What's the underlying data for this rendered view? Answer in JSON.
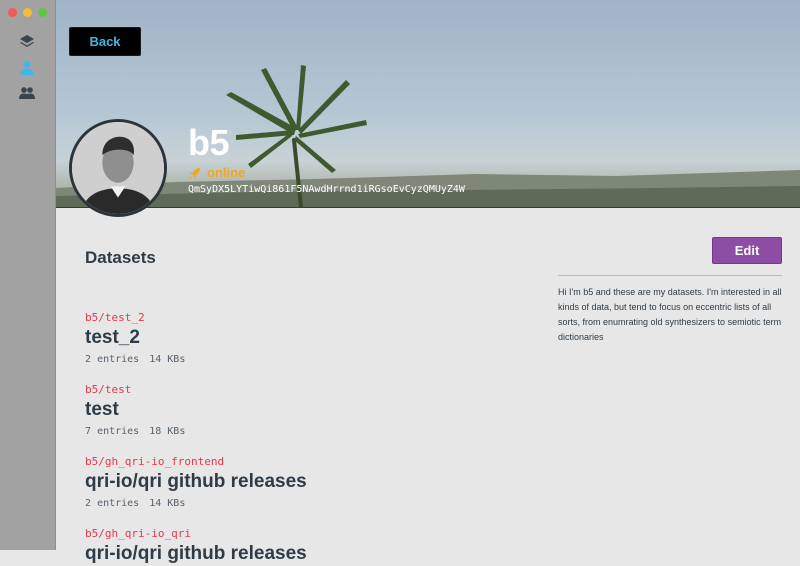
{
  "window": {
    "sidebar": {
      "icons": [
        "layers-icon",
        "user-icon",
        "users-icon"
      ],
      "active_icon": "user-icon",
      "active_color": "#3fb7e8"
    }
  },
  "header": {
    "back_label": "Back",
    "handle": "b5",
    "status": "online",
    "status_color": "#f3a421",
    "peer_id": "QmSyDX5LYTiwQi861F5NAwdHrrnd1iRGsoEvCyzQMUyZ4W"
  },
  "profile": {
    "edit_label": "Edit",
    "bio": "Hi I'm b5 and these are my datasets. I'm interested in all kinds of data, but tend to focus on eccentric lists of all sorts, from enumrating old synthesizers to semiotic term dictionaries"
  },
  "datasets": {
    "title": "Datasets",
    "items": [
      {
        "path": "b5/test_2",
        "name": "test_2",
        "entries": "2",
        "entries_label": "entries",
        "size": "14 KBs"
      },
      {
        "path": "b5/test",
        "name": "test",
        "entries": "7",
        "entries_label": "entries",
        "size": "18 KBs"
      },
      {
        "path": "b5/gh_qri-io_frontend",
        "name": "qri-io/qri github releases",
        "entries": "2",
        "entries_label": "entries",
        "size": "14 KBs"
      },
      {
        "path": "b5/gh_qri-io_qri",
        "name": "qri-io/qri github releases",
        "entries": "",
        "entries_label": "",
        "size": ""
      }
    ]
  }
}
